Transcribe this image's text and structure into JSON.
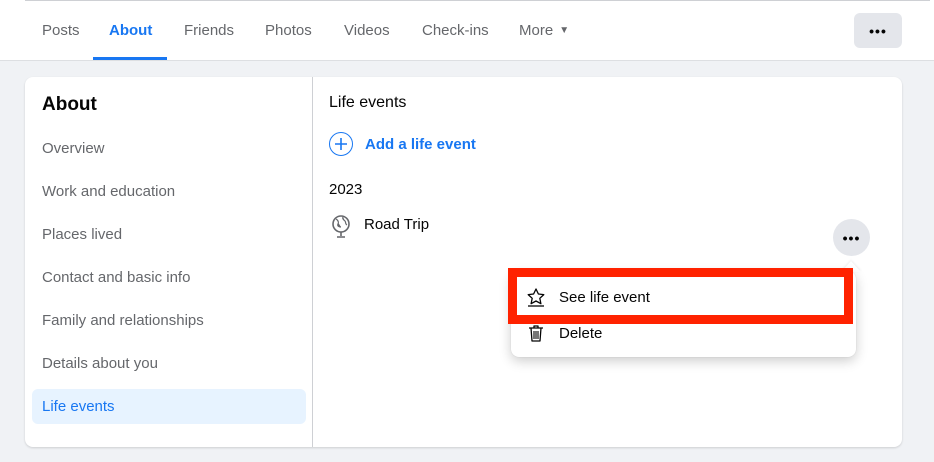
{
  "tabs": [
    {
      "label": "Posts",
      "active": false
    },
    {
      "label": "About",
      "active": true
    },
    {
      "label": "Friends",
      "active": false
    },
    {
      "label": "Photos",
      "active": false
    },
    {
      "label": "Videos",
      "active": false
    },
    {
      "label": "Check-ins",
      "active": false
    },
    {
      "label": "More",
      "active": false
    }
  ],
  "header_more_button": {
    "label": "•••",
    "icon": "more-horizontal-icon"
  },
  "sidebar": {
    "title": "About",
    "items": [
      {
        "label": "Overview",
        "active": false
      },
      {
        "label": "Work and education",
        "active": false
      },
      {
        "label": "Places lived",
        "active": false
      },
      {
        "label": "Contact and basic info",
        "active": false
      },
      {
        "label": "Family and relationships",
        "active": false
      },
      {
        "label": "Details about you",
        "active": false
      },
      {
        "label": "Life events",
        "active": true
      }
    ]
  },
  "main": {
    "section_title": "Life events",
    "add_event_label": "Add a life event",
    "year": "2023",
    "event": {
      "name": "Road Trip",
      "icon": "globe-icon"
    },
    "event_more_button": {
      "label": "•••"
    }
  },
  "context_menu": {
    "items": [
      {
        "label": "See life event",
        "icon": "star-icon"
      },
      {
        "label": "Delete",
        "icon": "trash-icon"
      }
    ]
  },
  "colors": {
    "accent": "#1877f2",
    "highlight": "#ff2200",
    "active_bg": "#e7f3ff",
    "page_bg": "#f0f2f5"
  }
}
